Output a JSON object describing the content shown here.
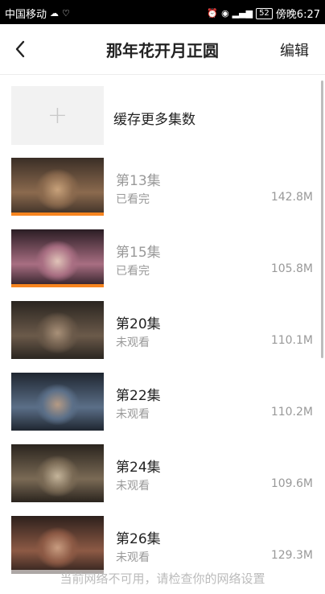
{
  "status_bar": {
    "carrier": "中国移动",
    "battery": "52",
    "time": "傍晚6:27"
  },
  "header": {
    "title": "那年花开月正圆",
    "edit_label": "编辑"
  },
  "add_item": {
    "plus": "+",
    "label": "缓存更多集数"
  },
  "episodes": [
    {
      "title": "第13集",
      "status": "已看完",
      "size": "142.8M",
      "watched": true,
      "progress": 1.0,
      "colors": [
        "#3a2e26",
        "#8b6a4e",
        "#c7a17a"
      ]
    },
    {
      "title": "第15集",
      "status": "已看完",
      "size": "105.8M",
      "watched": true,
      "progress": 1.0,
      "colors": [
        "#2b1d24",
        "#a86e82",
        "#e0c3b8"
      ]
    },
    {
      "title": "第20集",
      "status": "未观看",
      "size": "110.1M",
      "watched": false,
      "progress": 0,
      "colors": [
        "#2a2520",
        "#6b5a4a",
        "#a89078"
      ]
    },
    {
      "title": "第22集",
      "status": "未观看",
      "size": "110.2M",
      "watched": false,
      "progress": 0,
      "colors": [
        "#1f2630",
        "#5b6f88",
        "#b59a84"
      ]
    },
    {
      "title": "第24集",
      "status": "未观看",
      "size": "109.6M",
      "watched": false,
      "progress": 0,
      "colors": [
        "#2a241e",
        "#7a6a55",
        "#c4b49a"
      ]
    },
    {
      "title": "第26集",
      "status": "未观看",
      "size": "129.3M",
      "watched": false,
      "progress": 0,
      "colors": [
        "#2d201c",
        "#8d5a45",
        "#c89c80"
      ]
    }
  ],
  "toast": "当前网络不可用，请检查你的网络设置",
  "colors": {
    "accent": "#f7851f",
    "muted": "#999999"
  }
}
